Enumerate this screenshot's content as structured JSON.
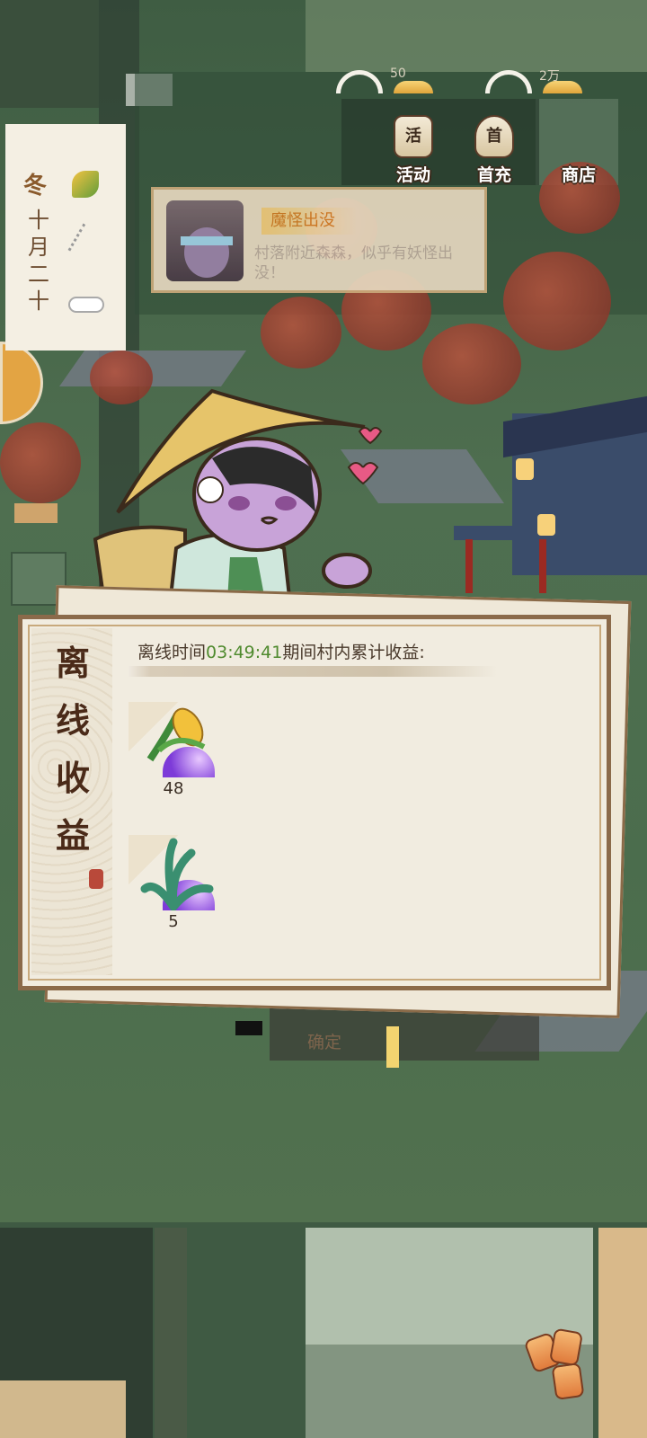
{
  "hud": {
    "resources": [
      {
        "icon": "sun-resource-icon",
        "value": "50"
      },
      {
        "icon": "sun-resource-icon",
        "value": "2万"
      }
    ],
    "buttons": [
      {
        "icon": "scroll-icon",
        "icon_char": "活",
        "label": "活动"
      },
      {
        "icon": "money-bag-icon",
        "icon_char": "首",
        "label": "首充"
      },
      {
        "icon": "shop-icon",
        "icon_char": "",
        "label": "商店"
      }
    ]
  },
  "calendar": {
    "season": "冬",
    "date_chars": [
      "十",
      "月",
      "二",
      "十"
    ],
    "icons": [
      "corn-icon",
      "wheat-icon",
      "cloud-icon"
    ]
  },
  "notice": {
    "title": "魔怪出没",
    "body": "村落附近森森，似乎有妖怪出没！"
  },
  "panel": {
    "title_chars": [
      "离",
      "线",
      "收",
      "益"
    ],
    "offline_prefix": "离线时间",
    "offline_time": "03:49:41",
    "offline_suffix": "期间村内累计收益:",
    "rewards": [
      {
        "icon": "corn-plant-icon",
        "count": "48"
      },
      {
        "icon": "seaweed-plant-icon",
        "count": "5"
      }
    ]
  },
  "confirm_label": "确定",
  "colors": {
    "panel_border": "#8b6a4a",
    "time_green": "#4f8a2e",
    "panel_bg": "#f1ece0"
  }
}
